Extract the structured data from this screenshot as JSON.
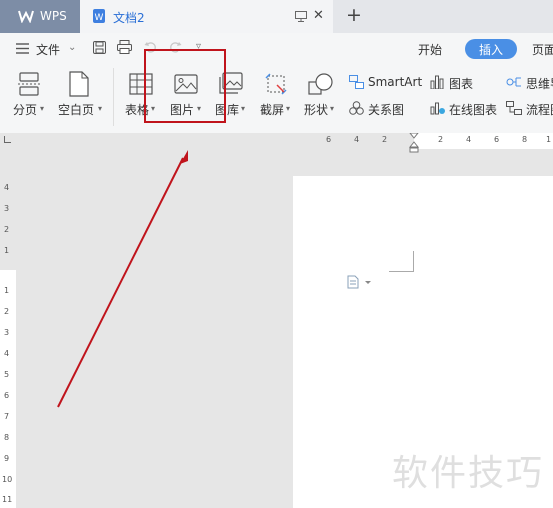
{
  "titlebar": {
    "app_tab": "WPS",
    "doc_tab": "文档2",
    "new_tab": "+",
    "close": "✕"
  },
  "menubar": {
    "file_label": "文件",
    "tabs": [
      {
        "label": "开始",
        "active": false
      },
      {
        "label": "插入",
        "active": true
      },
      {
        "label": "页面",
        "active": false
      }
    ]
  },
  "ribbon": {
    "page_break": "分页",
    "blank_page": "空白页",
    "table": "表格",
    "picture": "图片",
    "gallery": "图库",
    "screenshot": "截屏",
    "shapes": "形状",
    "smartart": "SmartArt",
    "relation": "关系图",
    "chart": "图表",
    "online_chart": "在线图表",
    "mindmap": "思维导",
    "flowchart": "流程图"
  },
  "hruler": {
    "left": [
      "6",
      "4",
      "2"
    ],
    "right": [
      "2",
      "4",
      "6",
      "8",
      "1"
    ]
  },
  "vruler": {
    "top": [
      "4",
      "3",
      "2",
      "1"
    ],
    "bottom": [
      "1",
      "2",
      "3",
      "4",
      "5",
      "6",
      "7",
      "8",
      "9",
      "10",
      "11"
    ]
  },
  "watermark": "软件技巧",
  "colors": {
    "accent": "#4a8fe5",
    "annotation_red": "#c0141c",
    "wps_tab": "#7d8da6"
  }
}
